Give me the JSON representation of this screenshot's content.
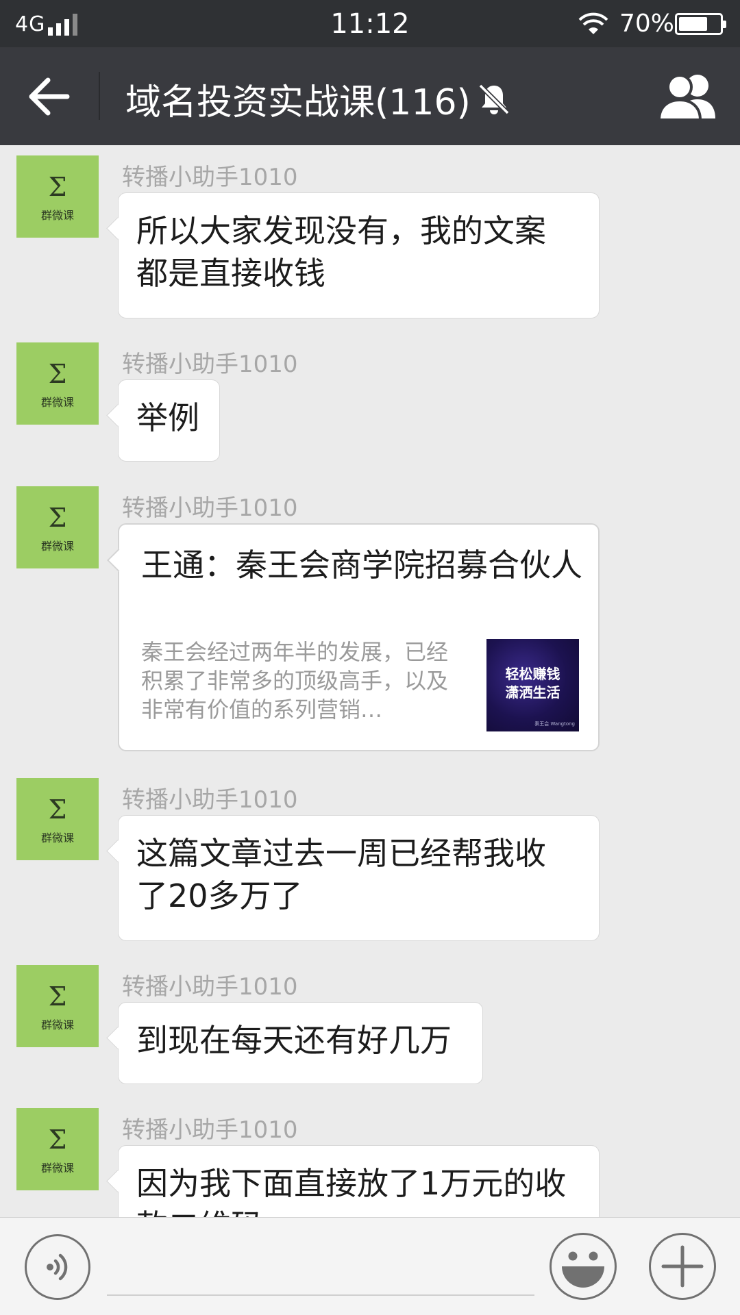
{
  "status_bar": {
    "network": "4G",
    "time": "11:12",
    "battery_percent_label": "70%",
    "battery_level": 0.7,
    "colors": {
      "background": "#2f3134"
    }
  },
  "header": {
    "title": "域名投资实战课(116)",
    "icons": {
      "back": "back-arrow-icon",
      "muted": "mute-bell-icon",
      "group": "group-members-icon"
    },
    "colors": {
      "background": "#393a3f"
    }
  },
  "avatar": {
    "symbol": "Σ",
    "label": "群微课",
    "color": "#9ccd63"
  },
  "messages": [
    {
      "sender": "转播小助手1010",
      "type": "text",
      "lines": [
        "所以大家发现没有，我的文案",
        "都是直接收钱"
      ]
    },
    {
      "sender": "转播小助手1010",
      "type": "text",
      "lines": [
        "举例"
      ]
    },
    {
      "sender": "转播小助手1010",
      "type": "link",
      "title": "王通：秦王会商学院招募合伙人",
      "description": "秦王会经过两年半的发展，已经积累了非常多的顶级高手，以及非常有价值的系列营销…",
      "thumb": {
        "line1": "轻松赚钱",
        "line2": "潇洒生活",
        "footer": "秦王会 Wangtong"
      }
    },
    {
      "sender": "转播小助手1010",
      "type": "text",
      "lines": [
        "这篇文章过去一周已经帮我收",
        "了20多万了"
      ]
    },
    {
      "sender": "转播小助手1010",
      "type": "text",
      "lines": [
        "到现在每天还有好几万"
      ]
    },
    {
      "sender": "转播小助手1010",
      "type": "text",
      "lines": [
        "因为我下面直接放了1万元的收",
        "款二维码"
      ]
    }
  ],
  "input_bar": {
    "icons": {
      "voice": "voice-input-icon",
      "emoji": "emoji-icon",
      "more": "plus-icon"
    },
    "background": "#f4f4f4"
  }
}
